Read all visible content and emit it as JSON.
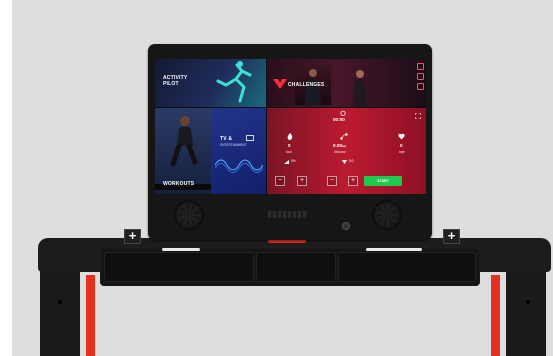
{
  "tiles": {
    "activity_pilot": "ACTIVITY\nPILOT",
    "challenges": "CHALLENGES",
    "workouts": "WORKOUTS",
    "tv_title": "TV &",
    "tv_subtitle": "ENTERTAINMENT"
  },
  "workout_panel": {
    "time": "00:00",
    "metrics": [
      {
        "icon": "flame-icon",
        "value": "0",
        "unit": "kcal"
      },
      {
        "icon": "route-icon",
        "value": "0.00",
        "suffix": "km",
        "unit": "distance"
      },
      {
        "icon": "heart-icon",
        "value": "0",
        "unit": "bpm"
      }
    ],
    "speed": "0%",
    "incline": "0.0",
    "start_label": "START",
    "controls": [
      "−",
      "+",
      "−",
      "+"
    ]
  },
  "hardware": {
    "left_plus": "+",
    "right_plus": "+"
  },
  "colors": {
    "accent_red": "#e22a1c",
    "start_green": "#20c84c",
    "panel_red": "#bb1a30",
    "body_black": "#1c1c1c"
  }
}
